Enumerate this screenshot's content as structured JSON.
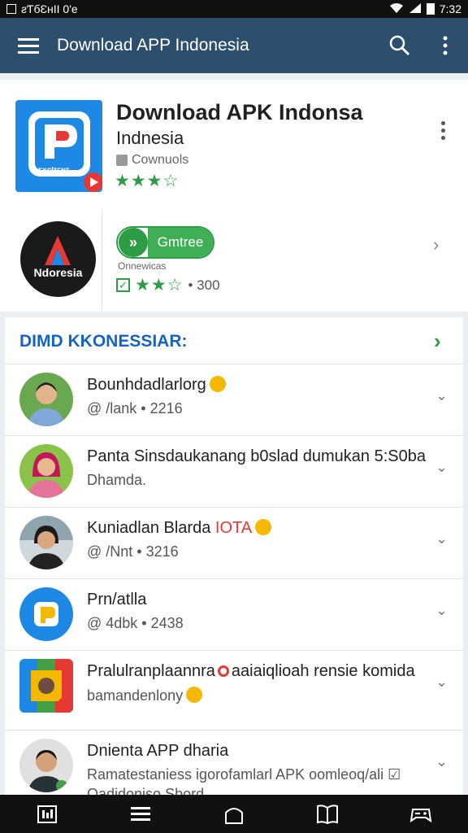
{
  "status_bar": {
    "left_text": "ƨƬбƐнΙΙ 0'e",
    "time": "7:32"
  },
  "app_bar": {
    "title": "Download APP Indonesia"
  },
  "featured": {
    "title": "Download APK Indonsa",
    "subtitle": "Indnesia",
    "developer": "Cownuols",
    "icon_label": "ᴇxᴄƖɪᴇɴɪ",
    "stars": "★★★☆"
  },
  "secondary_app": {
    "icon_label": "Ndoresia",
    "install_label": "Gmtree",
    "small_label": "Onnewicas",
    "stars": "★★☆",
    "count": "• 300"
  },
  "section": {
    "title": "DIMD KKONESSIAR:",
    "items": [
      {
        "title": "Bounhdadlarlorg",
        "subtitle": "@ /lank • 2216"
      },
      {
        "title": "Panta Sinsdaukanang  b0slad dumukan 5:S0ba",
        "subtitle": "Dhamda."
      },
      {
        "title": "Kuniadlan Blarda ",
        "title_red": "IOTA",
        "subtitle": "@ /Nnt • 3216"
      },
      {
        "title": "Prn/atlla",
        "subtitle": "@ 4dbk • 2438"
      },
      {
        "title": "Pralulranplaannra",
        "title_after": "aaiaiqlioah rensie komida",
        "subtitle": "bamandenlony"
      },
      {
        "title": "Dnienta APP dharia",
        "subtitle": "Ramatestaniess igorofamlarl APK oomleoq/ali ☑",
        "subtitle2": "Qadidoniso Sbord"
      }
    ]
  }
}
